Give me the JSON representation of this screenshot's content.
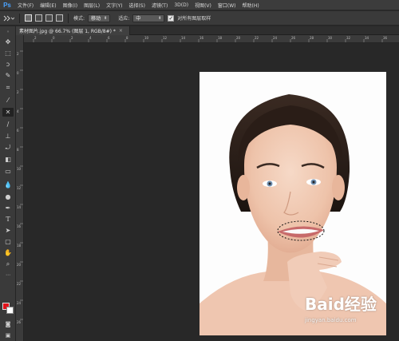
{
  "app": {
    "logo": "Ps"
  },
  "menu": [
    "文件(F)",
    "编辑(E)",
    "图像(I)",
    "图层(L)",
    "文字(Y)",
    "选择(S)",
    "滤镜(T)",
    "3D(D)",
    "视图(V)",
    "窗口(W)",
    "帮助(H)"
  ],
  "options": {
    "mode_label": "模式:",
    "mode_value": "移动",
    "adapt_label": "适应:",
    "adapt_value": "中",
    "sample_all_label": "对所有图层取样",
    "sample_all_checked": true
  },
  "document": {
    "tab_label": "素材图片.jpg @ 66.7% (图层 1, RGB/8#) *",
    "close_glyph": "×"
  },
  "ruler": {
    "h_ticks": [
      "2",
      "0",
      "2",
      "4",
      "6",
      "8",
      "10",
      "12",
      "14",
      "16",
      "18",
      "20",
      "22",
      "24",
      "26",
      "28",
      "30",
      "32",
      "34",
      "36"
    ],
    "v_ticks": [
      "2",
      "0",
      "2",
      "4",
      "6",
      "8",
      "10",
      "12",
      "14",
      "16",
      "18",
      "20",
      "22",
      "24",
      "26"
    ]
  },
  "tools": [
    {
      "name": "move-tool",
      "icon": "move-icon"
    },
    {
      "name": "marquee-tool",
      "icon": "marquee-icon"
    },
    {
      "name": "lasso-tool",
      "icon": "lasso-icon"
    },
    {
      "name": "quick-select-tool",
      "icon": "quick-select-icon"
    },
    {
      "name": "crop-tool",
      "icon": "crop-icon"
    },
    {
      "name": "eyedropper-tool",
      "icon": "eyedropper-icon"
    },
    {
      "name": "content-aware-move-tool",
      "icon": "content-aware-move-icon",
      "active": true
    },
    {
      "name": "brush-tool",
      "icon": "brush-icon"
    },
    {
      "name": "clone-stamp-tool",
      "icon": "clone-stamp-icon"
    },
    {
      "name": "history-brush-tool",
      "icon": "history-brush-icon"
    },
    {
      "name": "eraser-tool",
      "icon": "eraser-icon"
    },
    {
      "name": "gradient-tool",
      "icon": "gradient-icon"
    },
    {
      "name": "blur-tool",
      "icon": "blur-icon"
    },
    {
      "name": "dodge-tool",
      "icon": "dodge-icon"
    },
    {
      "name": "pen-tool",
      "icon": "pen-icon"
    },
    {
      "name": "type-tool",
      "icon": "type-icon"
    },
    {
      "name": "path-select-tool",
      "icon": "path-select-icon"
    },
    {
      "name": "shape-tool",
      "icon": "shape-icon"
    },
    {
      "name": "hand-tool",
      "icon": "hand-icon"
    },
    {
      "name": "zoom-tool",
      "icon": "zoom-icon"
    }
  ],
  "colors": {
    "foreground": "#e0121b",
    "background": "#ffffff"
  },
  "watermark": {
    "text": "Baid经验",
    "url": "jingyan.baidu.com"
  }
}
